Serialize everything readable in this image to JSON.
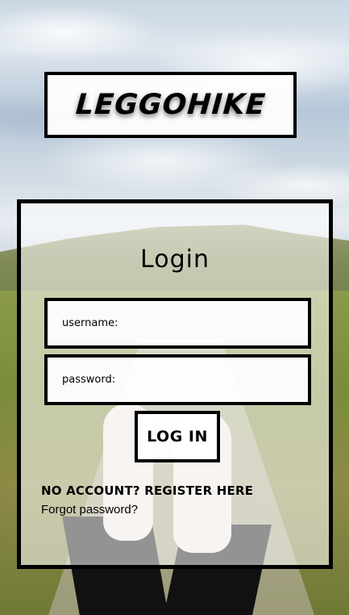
{
  "brand": {
    "logo_text": "LEGGOHIKE"
  },
  "login": {
    "title": "Login",
    "username_label": "username:",
    "username_value": "",
    "password_label": "password:",
    "password_value": "",
    "submit_label": "LOG IN",
    "register_link": "NO ACCOUNT? REGISTER HERE",
    "forgot_link": "Forgot password?"
  },
  "colors": {
    "border": "#000000",
    "panel": "#ffffff"
  }
}
